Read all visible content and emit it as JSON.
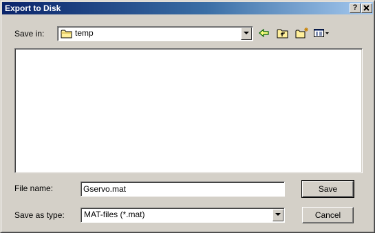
{
  "window": {
    "title": "Export to Disk",
    "help_button": "?",
    "close_button": "X"
  },
  "save_in": {
    "label": "Save in:",
    "folder": "temp",
    "folder_icon": "folder-icon"
  },
  "toolbar": {
    "back_icon": "back-arrow-icon",
    "up_icon": "up-one-level-icon",
    "new_folder_icon": "new-folder-icon",
    "view_menu_icon": "view-menu-icon"
  },
  "file_name": {
    "label": "File name:",
    "value": "Gservo.mat"
  },
  "save_as_type": {
    "label": "Save as type:",
    "selected": "MAT-files (*.mat)"
  },
  "buttons": {
    "save": "Save",
    "cancel": "Cancel"
  },
  "colors": {
    "title_bar_start": "#0a246a",
    "title_bar_end": "#a6caf0",
    "dialog_bg": "#d4d0c8"
  }
}
